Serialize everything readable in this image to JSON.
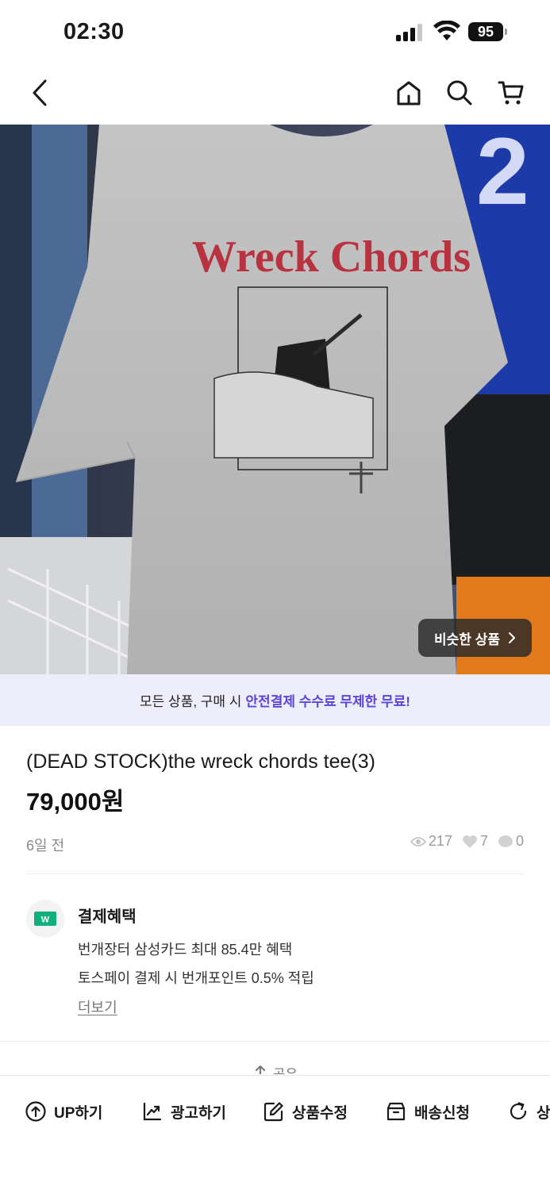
{
  "status_bar": {
    "time": "02:30",
    "battery": "95"
  },
  "product": {
    "image_text": "Wreck Chords",
    "similar_button": "비슷한 상품",
    "title": "(DEAD STOCK)the wreck chords tee(3)",
    "price": "79,000원",
    "posted": "6일 전",
    "views": "217",
    "likes": "7",
    "chats": "0"
  },
  "promo": {
    "text": "모든 상품, 구매 시",
    "highlight": "안전결제 수수료 무제한 무료!"
  },
  "benefits": {
    "icon_label": "W",
    "title": "결제혜택",
    "line1": "번개장터 삼성카드 최대 85.4만 혜택",
    "line2": "토스페이 결제 시 번개포인트 0.5% 적립",
    "more": "더보기"
  },
  "share": {
    "label": "공유"
  },
  "toolbar": {
    "up": "UP하기",
    "ad": "광고하기",
    "edit": "상품수정",
    "delivery": "배송신청",
    "refresh": "상"
  },
  "colors": {
    "accent": "#5b44d9",
    "banner_bg": "#eeedfb",
    "payment_green": "#10b07a"
  }
}
